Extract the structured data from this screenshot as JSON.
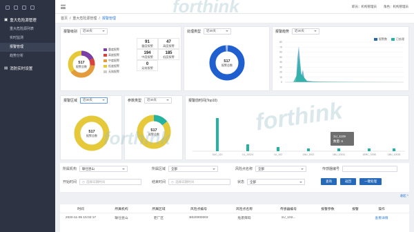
{
  "topbar": {
    "role_label": "职员：机构管理员",
    "user_label": "角色：机构管理员"
  },
  "sidebar": {
    "group1": "重大危险源管理",
    "items": [
      "重大危险源列表",
      "实时监测",
      "报警管理",
      "趋势分析"
    ],
    "group2": "消防实时设置"
  },
  "breadcrumb": {
    "home": "首页",
    "sep": "/",
    "level2": "重大危险源管理",
    "current": "报警管理"
  },
  "panels": {
    "levels": {
      "title": "报警级别",
      "period": "近30天",
      "donut_value": "517",
      "donut_label": "报警总数",
      "legend": [
        "重度报警",
        "高度报警",
        "中度报警",
        "低度报警",
        "无效报警"
      ],
      "stats": [
        {
          "value": "91",
          "label": "重度报警"
        },
        {
          "value": "47",
          "label": "高度报警"
        },
        {
          "value": "194",
          "label": "中度报警"
        },
        {
          "value": "185",
          "label": "低度报警"
        },
        {
          "value": "0",
          "label": "无效报警"
        }
      ]
    },
    "handling": {
      "title": "处理类型",
      "period": "近30天",
      "donut_value": "517",
      "donut_label": "报警总数"
    },
    "trend": {
      "title": "报警趋势",
      "period": "近30天",
      "legend": [
        "报警数",
        "已处理"
      ],
      "y_ticks": [
        "80",
        "70",
        "60",
        "50",
        "40",
        "30",
        "20",
        "10",
        "0"
      ]
    },
    "region": {
      "title": "报警区域",
      "period": "近30天",
      "donut_value": "517",
      "donut_label": "报警总数"
    },
    "param": {
      "title": "参数类型",
      "period": "近30天",
      "donut_value": "517",
      "donut_label": "报警总数"
    },
    "top10": {
      "title": "报警前时间(Top10)",
      "x_labels": [
        "SUC_110",
        "1U_10024",
        "1U_102",
        "1BU_1002",
        "1BU_10011",
        "1BRC_1008",
        "1BU_10025"
      ],
      "tooltip_title": "1U_1109",
      "tooltip_value": "数量: 6"
    }
  },
  "filters": {
    "org_label": "所属机构",
    "org_value": "联仕昆山",
    "area_label": "所属区域",
    "area_value": "全部",
    "risk_label": "风险点名称",
    "risk_value": "全部",
    "sensor_label": "传感器编号",
    "sensor_value": "",
    "start_label": "开始时间",
    "start_placeholder": "选择日期时间",
    "end_label": "结束时间",
    "end_placeholder": "选择日期时间",
    "status_label": "状态",
    "status_value": "全部",
    "query_button": "查询",
    "reset_button": "返回",
    "batch_button": "一键处理",
    "collapse_link": "收起 ^"
  },
  "table": {
    "headers": [
      "时间",
      "所属机构",
      "所属区域",
      "风险点编号",
      "风险点名称",
      "传感器编号",
      "报警参数",
      "报警",
      "操作"
    ],
    "rows": [
      [
        "2020-11-05 15:02:17",
        "联仕昆山",
        "老厂区",
        "B020000003",
        "危废库码",
        "1U_102...",
        "",
        "",
        "查看详情"
      ]
    ]
  },
  "colors": {
    "accent": "#2569b8",
    "teal": "#25b2a3",
    "navy": "#2a69a8",
    "donut_blue": "#1f5fcf",
    "donut_yellow": "#e6c93a"
  },
  "watermark": "forthink"
}
